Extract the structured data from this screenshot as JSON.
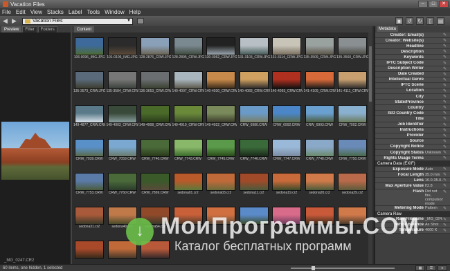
{
  "window": {
    "title": "Vacation Files"
  },
  "menu": [
    "File",
    "Edit",
    "View",
    "Stacks",
    "Label",
    "Tools",
    "Window",
    "Help"
  ],
  "toolbar": {
    "path": "Vacation Files"
  },
  "left_tabs": [
    "Preview",
    "Filter",
    "Folders"
  ],
  "preview": {
    "filename": "_MG_0247.CR2"
  },
  "content_tab": "Content",
  "meta_tab": "Metadata",
  "thumbnails": [
    {
      "name": "106-0096_IMG.JPG",
      "c1": "#3d6a9a",
      "c2": "#4e6a35"
    },
    {
      "name": "101-0106_IMG.JPG",
      "c1": "#2b2b2b",
      "c2": "#5b4a3a"
    },
    {
      "name": "128-2876_CRW.JPG",
      "c1": "#8aa0b8",
      "c2": "#6b6452"
    },
    {
      "name": "128-2895_CRW.JPG",
      "c1": "#7a8890",
      "c2": "#3e4a3e"
    },
    {
      "name": "130-3062_CRW.JPG",
      "c1": "#222",
      "c2": "#9aa6ae"
    },
    {
      "name": "131-3103_CRW.JPG",
      "c1": "#b8c0c6",
      "c2": "#465a58"
    },
    {
      "name": "131-3114_CRW.JPG",
      "c1": "#c8c4b8",
      "c2": "#7a7060"
    },
    {
      "name": "135-3509_CRW.JPG",
      "c1": "#9aa2a0",
      "c2": "#5a5448"
    },
    {
      "name": "135-3560_CRW.JPG",
      "c1": "#8a8f92",
      "c2": "#4a4a42"
    },
    {
      "name": "135-3573_CRW.JPG",
      "c1": "#5a6a7a",
      "c2": "#3b3b2d"
    },
    {
      "name": "135-3584_CRW.CRW",
      "c1": "#777",
      "c2": "#3a3f3a"
    },
    {
      "name": "136-3653_CRW.CRW",
      "c1": "#6a6e70",
      "c2": "#3a4030"
    },
    {
      "name": "140-4007_CRW.CRW",
      "c1": "#a9b6be",
      "c2": "#5a564a"
    },
    {
      "name": "140-4030_CRW.CRW",
      "c1": "#c88a4a",
      "c2": "#3a2a1a"
    },
    {
      "name": "140-4083_CRW.CRW",
      "c1": "#d0a060",
      "c2": "#2a2a2a"
    },
    {
      "name": "140-4093_CRW.CRW",
      "c1": "#b03020",
      "c2": "#101010"
    },
    {
      "name": "141-4109_CRW.CRW",
      "c1": "#d86a3a",
      "c2": "#1a1a1a"
    },
    {
      "name": "141-4111_CRW.CRW",
      "c1": "#c8a070",
      "c2": "#2a2a2a"
    },
    {
      "name": "149-4877_CRW.CRW",
      "c1": "#5a7a8a",
      "c2": "#d8e0e8"
    },
    {
      "name": "149-4903_CRW.CRW",
      "c1": "#3a4a3a",
      "c2": "#8aa0a0"
    },
    {
      "name": "149-4908_CRW.CRW",
      "c1": "#4a6a2a",
      "c2": "#2a3a1a"
    },
    {
      "name": "149-4919_CRW.CRW",
      "c1": "#6a8a3a",
      "c2": "#3a4a2a"
    },
    {
      "name": "149-4922_CRW.CRW",
      "c1": "#7a8a5a",
      "c2": "#3a3a2a"
    },
    {
      "name": "CRW_6980.CRW",
      "c1": "#6a9ac8",
      "c2": "#7a7e62"
    },
    {
      "name": "CRW_6992.CRW",
      "c1": "#4a86c8",
      "c2": "#5a6a4a"
    },
    {
      "name": "CRW_6993.CRW",
      "c1": "#6aa0d0",
      "c2": "#4a5a3a"
    },
    {
      "name": "CRW_7002.CRW",
      "c1": "#8ab0d0",
      "c2": "#6a7a5a"
    },
    {
      "name": "CRW_7039.CRW",
      "c1": "#5a90c8",
      "c2": "#5a6a4a"
    },
    {
      "name": "CRW_7059.CRW",
      "c1": "#7aa8d0",
      "c2": "#6a7a6a"
    },
    {
      "name": "CRW_7740.CRW",
      "c1": "#4a6a3a",
      "c2": "#2a3a1a"
    },
    {
      "name": "CRW_7743.CRW",
      "c1": "#8ab86a",
      "c2": "#3a6a2a"
    },
    {
      "name": "CRW_7745.CRW",
      "c1": "#5a9a4a",
      "c2": "#2a4a1a"
    },
    {
      "name": "CRW_7746.CRW",
      "c1": "#3a6a3a",
      "c2": "#1a2a1a"
    },
    {
      "name": "CRW_7747.CRW",
      "c1": "#9ab8d8",
      "c2": "#7a8aa0"
    },
    {
      "name": "CRW_7748.CRW",
      "c1": "#8aa8c8",
      "c2": "#6a8a6a"
    },
    {
      "name": "CRW_7750.CRW",
      "c1": "#6a8ab8",
      "c2": "#4a6a4a"
    },
    {
      "name": "CRW_7753.CRW",
      "c1": "#5a7aa8",
      "c2": "#4a5a3a"
    },
    {
      "name": "CRW_7760.CRW",
      "c1": "#4a6a3a",
      "c2": "#2a3a2a"
    },
    {
      "name": "CRW_7869.CRW",
      "c1": "#3a5a2a",
      "c2": "#5a4a3a"
    },
    {
      "name": "sedona01.cr2",
      "c1": "#b85a2a",
      "c2": "#5a7a3a"
    },
    {
      "name": "sedona03.cr2",
      "c1": "#c06a3a",
      "c2": "#6a6a3a"
    },
    {
      "name": "sedona11.cr2",
      "c1": "#a04a2a",
      "c2": "#4a5a3a"
    },
    {
      "name": "sedona19.cr2",
      "c1": "#c86a3a",
      "c2": "#3a4a2a"
    },
    {
      "name": "sedona20.cr2",
      "c1": "#d07a4a",
      "c2": "#4a5a3a"
    },
    {
      "name": "sedona29.cr2",
      "c1": "#b86a4a",
      "c2": "#5a5a3a"
    },
    {
      "name": "sedona31.cr2",
      "c1": "#a85a3a",
      "c2": "#3a3a2a"
    },
    {
      "name": "sedona40.cr2",
      "c1": "#c07a4a",
      "c2": "#4a4a2a"
    },
    {
      "name": "sedona54.cr2",
      "c1": "#904a2a",
      "c2": "#3a3a2a"
    },
    {
      "name": "",
      "c1": "#c8603a",
      "c2": "#4a3a2a"
    },
    {
      "name": "",
      "c1": "#d07040",
      "c2": "#5a4a3a"
    },
    {
      "name": "",
      "c1": "#5a8ac8",
      "c2": "#3a4a2a"
    },
    {
      "name": "",
      "c1": "#d86a8a",
      "c2": "#6a3a5a"
    },
    {
      "name": "",
      "c1": "#c85a3a",
      "c2": "#3a2a1a"
    },
    {
      "name": "",
      "c1": "#d07a4a",
      "c2": "#4a3a2a"
    },
    {
      "name": "",
      "c1": "#a84a2a",
      "c2": "#3a2a1a"
    },
    {
      "name": "",
      "c1": "#c06a3a",
      "c2": "#4a3a2a"
    },
    {
      "name": "",
      "c1": "#b85a3a",
      "c2": "#3a2a2a"
    }
  ],
  "metadata": {
    "fields": [
      {
        "k": "Creator: Email(s)",
        "v": ""
      },
      {
        "k": "Creator: Website(s)",
        "v": ""
      },
      {
        "k": "Headline",
        "v": ""
      },
      {
        "k": "Description",
        "v": ""
      },
      {
        "k": "Keywords",
        "v": ""
      },
      {
        "k": "IPTC Subject Code",
        "v": ""
      },
      {
        "k": "Description Writer",
        "v": ""
      },
      {
        "k": "Date Created",
        "v": ""
      },
      {
        "k": "Intellectual Genre",
        "v": ""
      },
      {
        "k": "IPTC Scene",
        "v": ""
      },
      {
        "k": "Location",
        "v": ""
      },
      {
        "k": "City",
        "v": ""
      },
      {
        "k": "State/Province",
        "v": ""
      },
      {
        "k": "Country",
        "v": ""
      },
      {
        "k": "ISO Country Code",
        "v": ""
      },
      {
        "k": "Title",
        "v": ""
      },
      {
        "k": "Job Identifier",
        "v": ""
      },
      {
        "k": "Instructions",
        "v": ""
      },
      {
        "k": "Provider",
        "v": ""
      },
      {
        "k": "Source",
        "v": ""
      },
      {
        "k": "Copyright Notice",
        "v": ""
      },
      {
        "k": "Copyright Status",
        "v": "Unknown"
      },
      {
        "k": "Rights Usage Terms",
        "v": ""
      }
    ],
    "camera_head": "Camera Data (EXIF)",
    "camera": [
      {
        "k": "Exposure Mode",
        "v": "Auto"
      },
      {
        "k": "Focal Length",
        "v": "35.0 mm"
      },
      {
        "k": "Lens",
        "v": "16.0-35.0..."
      },
      {
        "k": "Max Aperture Value",
        "v": "f/2.8"
      },
      {
        "k": "Flash",
        "v": "Did not fire, compulsory mode",
        "tall": true
      },
      {
        "k": "Metering Mode",
        "v": "Pattern"
      }
    ],
    "raw_head": "Camera Raw",
    "raw": [
      {
        "k": "Raw Filename",
        "v": "_MG_024..."
      },
      {
        "k": "White Balance",
        "v": "As Shot"
      },
      {
        "k": "Temperature",
        "v": "4600 K"
      }
    ]
  },
  "status": {
    "text": "60 items, one hidden, 1 selected"
  },
  "watermark": {
    "line1": "МоиПрограммы.COM",
    "line2": "Каталог бесплатных программ"
  }
}
